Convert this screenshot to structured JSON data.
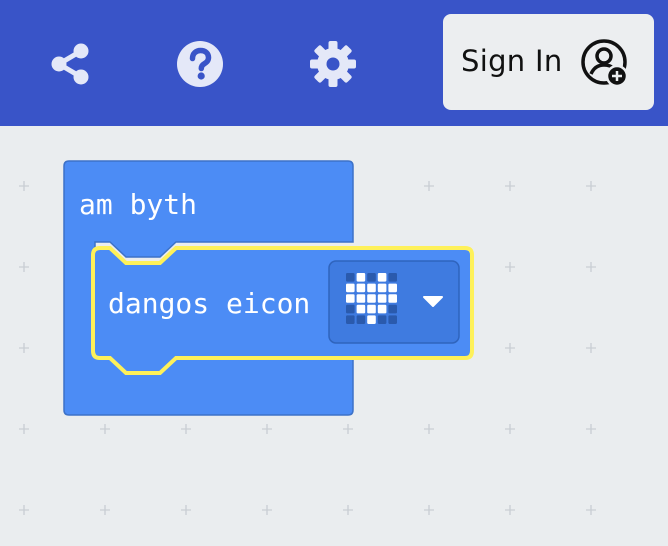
{
  "header": {
    "share_icon": "share-icon",
    "help_icon": "help-icon",
    "settings_icon": "gear-icon",
    "sign_in_label": "Sign In",
    "sign_in_icon": "user-plus-icon",
    "bg_color": "#3954c8"
  },
  "workspace": {
    "on_start_block": {
      "label": "am byth",
      "color": "#4c8cf5"
    },
    "show_icon_block": {
      "label": "dangos eicon",
      "color": "#4c8cf5",
      "highlight_color": "#fef15a",
      "icon_value": "heart",
      "dropdown_icon": "caret-down-icon"
    }
  }
}
